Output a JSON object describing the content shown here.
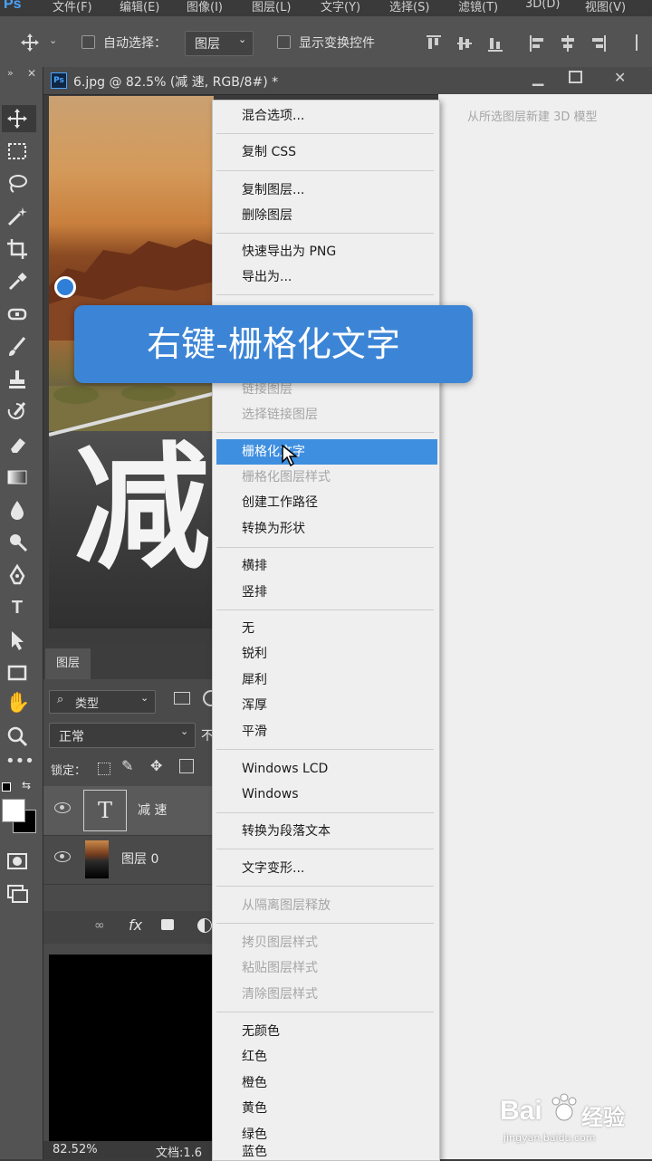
{
  "app": {
    "logo": "Ps"
  },
  "menubar": {
    "items": [
      "文件(F)",
      "编辑(E)",
      "图像(I)",
      "图层(L)",
      "文字(Y)",
      "选择(S)",
      "滤镜(T)",
      "3D(D)",
      "视图(V)"
    ]
  },
  "options": {
    "auto_select_label": "自动选择：",
    "auto_select_value": "图层",
    "show_transform_label": "显示变换控件"
  },
  "document": {
    "tab_title": "6.jpg @ 82.5% (减 速, RGB/8#) *",
    "canvas_text": "减"
  },
  "layers_panel": {
    "tab": "图层",
    "filter_label": "类型",
    "blend_mode": "正常",
    "blend_extra": "不",
    "lock_label": "锁定：",
    "layers": [
      {
        "name": "减 速",
        "thumb": "T"
      },
      {
        "name": "图层 0"
      }
    ],
    "footer_fx": "fx"
  },
  "status": {
    "zoom": "82.52%",
    "doc_info": "文档:1.6"
  },
  "right_panel": {
    "hint": "从所选图层新建 3D 模型"
  },
  "context_menu": {
    "items": [
      {
        "label": "混合选项...",
        "disabled": false
      },
      {
        "label": "复制 CSS",
        "disabled": false
      },
      {
        "label": "复制图层...",
        "disabled": false
      },
      {
        "label": "删除图层",
        "disabled": false
      },
      {
        "label": "快速导出为 PNG",
        "disabled": false
      },
      {
        "label": "导出为...",
        "disabled": false
      },
      {
        "label": "链接图层",
        "disabled": true
      },
      {
        "label": "选择链接图层",
        "disabled": true
      },
      {
        "label": "栅格化文字",
        "disabled": false,
        "highlighted": true
      },
      {
        "label": "栅格化图层样式",
        "disabled": true
      },
      {
        "label": "创建工作路径",
        "disabled": false
      },
      {
        "label": "转换为形状",
        "disabled": false
      },
      {
        "label": "横排",
        "disabled": false
      },
      {
        "label": "竖排",
        "disabled": false
      },
      {
        "label": "无",
        "disabled": false
      },
      {
        "label": "锐利",
        "disabled": false
      },
      {
        "label": "犀利",
        "disabled": false
      },
      {
        "label": "浑厚",
        "disabled": false
      },
      {
        "label": "平滑",
        "disabled": false
      },
      {
        "label": "Windows LCD",
        "disabled": false
      },
      {
        "label": "Windows",
        "disabled": false
      },
      {
        "label": "转换为段落文本",
        "disabled": false
      },
      {
        "label": "文字变形...",
        "disabled": false
      },
      {
        "label": "从隔离图层释放",
        "disabled": true
      },
      {
        "label": "拷贝图层样式",
        "disabled": true
      },
      {
        "label": "粘贴图层样式",
        "disabled": true
      },
      {
        "label": "清除图层样式",
        "disabled": true
      },
      {
        "label": "无颜色",
        "disabled": false
      },
      {
        "label": "红色",
        "disabled": false
      },
      {
        "label": "橙色",
        "disabled": false
      },
      {
        "label": "黄色",
        "disabled": false
      },
      {
        "label": "绿色",
        "disabled": false
      },
      {
        "label": "蓝色",
        "disabled": false
      }
    ]
  },
  "banner": {
    "text": "右键-栅格化文字"
  },
  "watermark": {
    "brand": "Bai",
    "brand_suffix": "经验",
    "url": "jingyan.baidu.com"
  },
  "colors": {
    "highlight": "#3f8fe0",
    "banner": "#3c85d6",
    "logo_blue": "#4aa3ff",
    "menu_bg": "#efefef",
    "panel_dark": "#535353"
  }
}
